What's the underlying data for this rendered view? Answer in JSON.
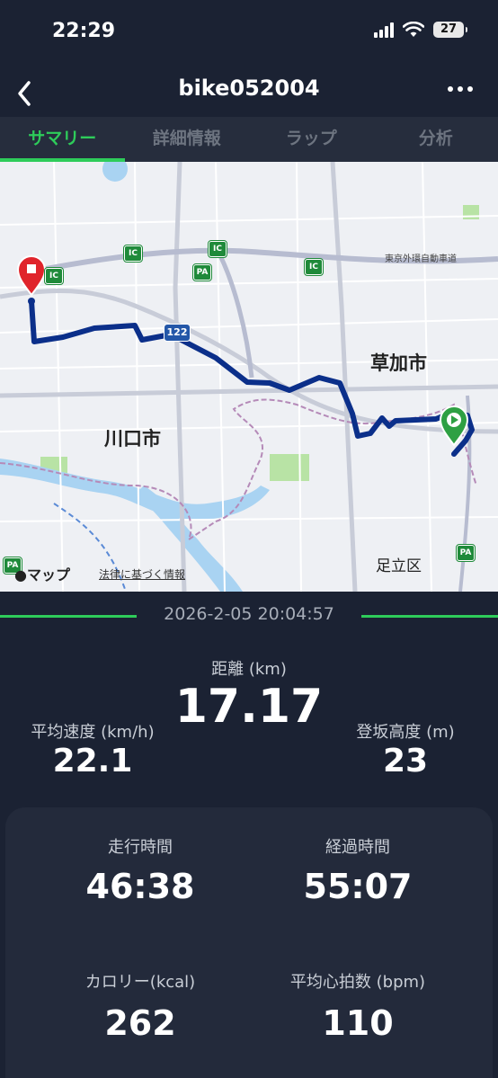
{
  "status_bar": {
    "time": "22:29",
    "battery": "27"
  },
  "nav": {
    "title": "bike052004"
  },
  "tabs": [
    {
      "label": "サマリー"
    },
    {
      "label": "詳細情報"
    },
    {
      "label": "ラップ"
    },
    {
      "label": "分析"
    }
  ],
  "map": {
    "city_kawaguchi": "川口市",
    "city_soka": "草加市",
    "area_adachi": "足立区",
    "expressway": "東京外環自動車道",
    "route_number": "122",
    "ic_label": "IC",
    "pa_label": "PA",
    "attribution": "マップ",
    "legal": "法律に基づく情報",
    "colors": {
      "route": "#0b2f8a",
      "start": "#2ea043",
      "end": "#e0242b"
    }
  },
  "summary": {
    "datetime": "2026-2-05 20:04:57",
    "distance_label": "距離 (km)",
    "distance_value": "17.17",
    "avg_speed_label": "平均速度 (km/h)",
    "avg_speed_value": "22.1",
    "climb_label": "登坂高度 (m)",
    "climb_value": "23"
  },
  "details": {
    "moving_time_label": "走行時間",
    "moving_time_value": "46:38",
    "elapsed_time_label": "経過時間",
    "elapsed_time_value": "55:07",
    "calories_label": "カロリー(kcal)",
    "calories_value": "262",
    "avg_hr_label": "平均心拍数 (bpm)",
    "avg_hr_value": "110"
  }
}
